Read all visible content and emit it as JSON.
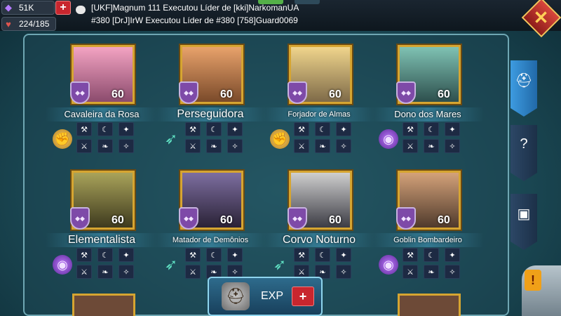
{
  "resources": {
    "gems": {
      "value": "51K",
      "icon": "gem-icon"
    },
    "stamina": {
      "value": "224/185",
      "icon": "heart-icon"
    }
  },
  "chat": {
    "line1": "[UKF]Magnum 111 Executou Líder de [kki]NarkomanUA",
    "line2": "#380 [DrJ]IrW Executou Líder de #380 [758]Guard0069"
  },
  "close_glyph": "✕",
  "plus_glyph": "+",
  "heroes": [
    {
      "name": "Cavaleira da Rosa",
      "level": "60",
      "class": "fist",
      "class_glyph": "✊"
    },
    {
      "name": "Perseguidora",
      "level": "60",
      "class": "wing",
      "class_glyph": "➶"
    },
    {
      "name": "Forjador de Almas",
      "level": "60",
      "class": "fist",
      "class_glyph": "✊"
    },
    {
      "name": "Dono dos Mares",
      "level": "60",
      "class": "orb",
      "class_glyph": "◉"
    },
    {
      "name": "Elementalista",
      "level": "60",
      "class": "orb",
      "class_glyph": "◉"
    },
    {
      "name": "Matador de Demônios",
      "level": "60",
      "class": "wing",
      "class_glyph": "➶"
    },
    {
      "name": "Corvo Noturno",
      "level": "60",
      "class": "wing",
      "class_glyph": "➶"
    },
    {
      "name": "Goblin Bombardeiro",
      "level": "60",
      "class": "orb",
      "class_glyph": "◉"
    }
  ],
  "side_tabs": [
    {
      "icon": "helmet-icon",
      "glyph": "⛑",
      "active": true
    },
    {
      "icon": "question-shield-icon",
      "glyph": "?",
      "active": false
    },
    {
      "icon": "chest-icon",
      "glyph": "▣",
      "active": false
    }
  ],
  "exp_button": {
    "label": "EXP",
    "plus": "+"
  },
  "alert_glyph": "!"
}
